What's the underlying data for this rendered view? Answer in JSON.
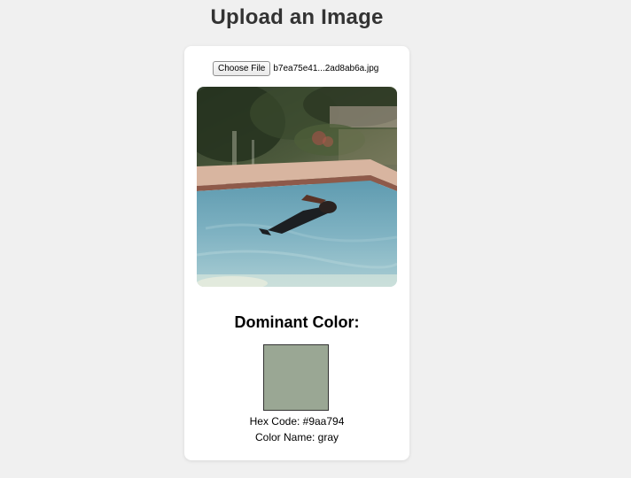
{
  "page": {
    "title": "Upload an Image"
  },
  "upload": {
    "button_label": "Choose File",
    "file_name": "b7ea75e41...2ad8ab6a.jpg"
  },
  "result": {
    "heading": "Dominant Color:",
    "swatch_color": "#9aa794",
    "hex_line": "Hex Code: #9aa794",
    "name_line": "Color Name: gray"
  }
}
